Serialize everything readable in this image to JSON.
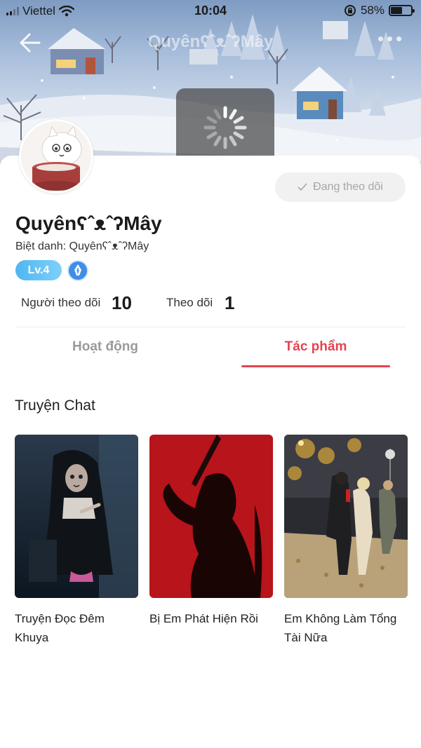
{
  "status_bar": {
    "carrier": "Viettel",
    "time": "10:04",
    "battery_percent": "58%",
    "battery_level": 0.58,
    "icons": [
      "signal-icon",
      "wifi-icon",
      "rotation-lock-icon",
      "battery-icon"
    ]
  },
  "nav": {
    "title": "QuyênʕˆᴥˆʔMây",
    "back_icon": "back-arrow-icon",
    "more_icon": "more-dots-icon"
  },
  "profile": {
    "name": "QuyênʕˆᴥˆʔMây",
    "nickname_label": "Biệt danh: ",
    "nickname_value": "QuyênʕˆᴥˆʔMây",
    "level": "Lv.4",
    "follow_button": "Đang theo dõi",
    "followers_label": "Người theo dõi",
    "followers_count": "10",
    "following_label": "Theo dõi",
    "following_count": "1"
  },
  "tabs": [
    {
      "label": "Hoạt động",
      "active": false
    },
    {
      "label": "Tác phẩm",
      "active": true
    }
  ],
  "section_title": "Truyện Chat",
  "books": [
    {
      "title": "Truyện Đọc Đêm Khuya"
    },
    {
      "title": "Bị Em Phát Hiện Rồi"
    },
    {
      "title": "Em Không Làm Tổng Tài Nữa"
    }
  ],
  "colors": {
    "accent": "#e3444f",
    "level_badge": "#4fb6f1",
    "follow_button_bg": "#f1f1f1",
    "follow_button_text": "#a6a6a6"
  }
}
